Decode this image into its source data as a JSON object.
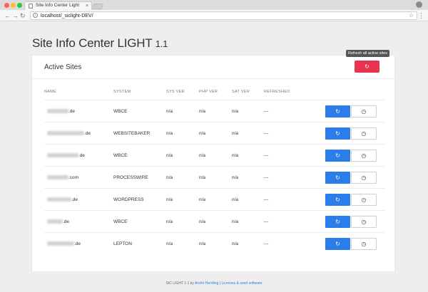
{
  "browser": {
    "tab_title": "Site Info Center Light",
    "tab_close": "×",
    "url": "localhost/_siclight-DEV/",
    "back": "←",
    "forward": "→",
    "reload": "↻",
    "star": "☆",
    "menu": "⋮",
    "info": "i"
  },
  "page": {
    "title": "Site Info Center LIGHT",
    "version": "1.1"
  },
  "card": {
    "title": "Active Sites",
    "refresh_all_tooltip": "Refresh all active sites",
    "refresh_all_icon": "↻"
  },
  "table": {
    "columns": [
      "NAME",
      "SYSTEM",
      "SYS VER",
      "PHP VER",
      "SAT VER",
      "REFRESHED"
    ],
    "refresh_icon": "↻",
    "history_icon": "◷",
    "rows": [
      {
        "name_suffix": ".de",
        "system": "WBCE",
        "sys_ver": "n/a",
        "php_ver": "n/a",
        "sat_ver": "n/a",
        "refreshed": "---"
      },
      {
        "name_suffix": ".de",
        "system": "WEBSITEBAKER",
        "sys_ver": "n/a",
        "php_ver": "n/a",
        "sat_ver": "n/a",
        "refreshed": "---"
      },
      {
        "name_suffix": ".de",
        "system": "WBCE",
        "sys_ver": "n/a",
        "php_ver": "n/a",
        "sat_ver": "n/a",
        "refreshed": "---"
      },
      {
        "name_suffix": ".com",
        "system": "PROCESSWIRE",
        "sys_ver": "n/a",
        "php_ver": "n/a",
        "sat_ver": "n/a",
        "refreshed": "---"
      },
      {
        "name_suffix": ".de",
        "system": "WORDPRESS",
        "sys_ver": "n/a",
        "php_ver": "n/a",
        "sat_ver": "n/a",
        "refreshed": "---"
      },
      {
        "name_suffix": ".de",
        "system": "WBCE",
        "sys_ver": "n/a",
        "php_ver": "n/a",
        "sat_ver": "n/a",
        "refreshed": "---"
      },
      {
        "name_suffix": ".de",
        "system": "LEPTON",
        "sys_ver": "n/a",
        "php_ver": "n/a",
        "sat_ver": "n/a",
        "refreshed": "---"
      }
    ]
  },
  "footer": {
    "text": "SIC LIGHT 1.1 by",
    "author": "André Herdling",
    "separator": "|",
    "license": "Licenses & used software"
  },
  "colors": {
    "primary": "#2b7de9",
    "danger": "#e8344e"
  }
}
